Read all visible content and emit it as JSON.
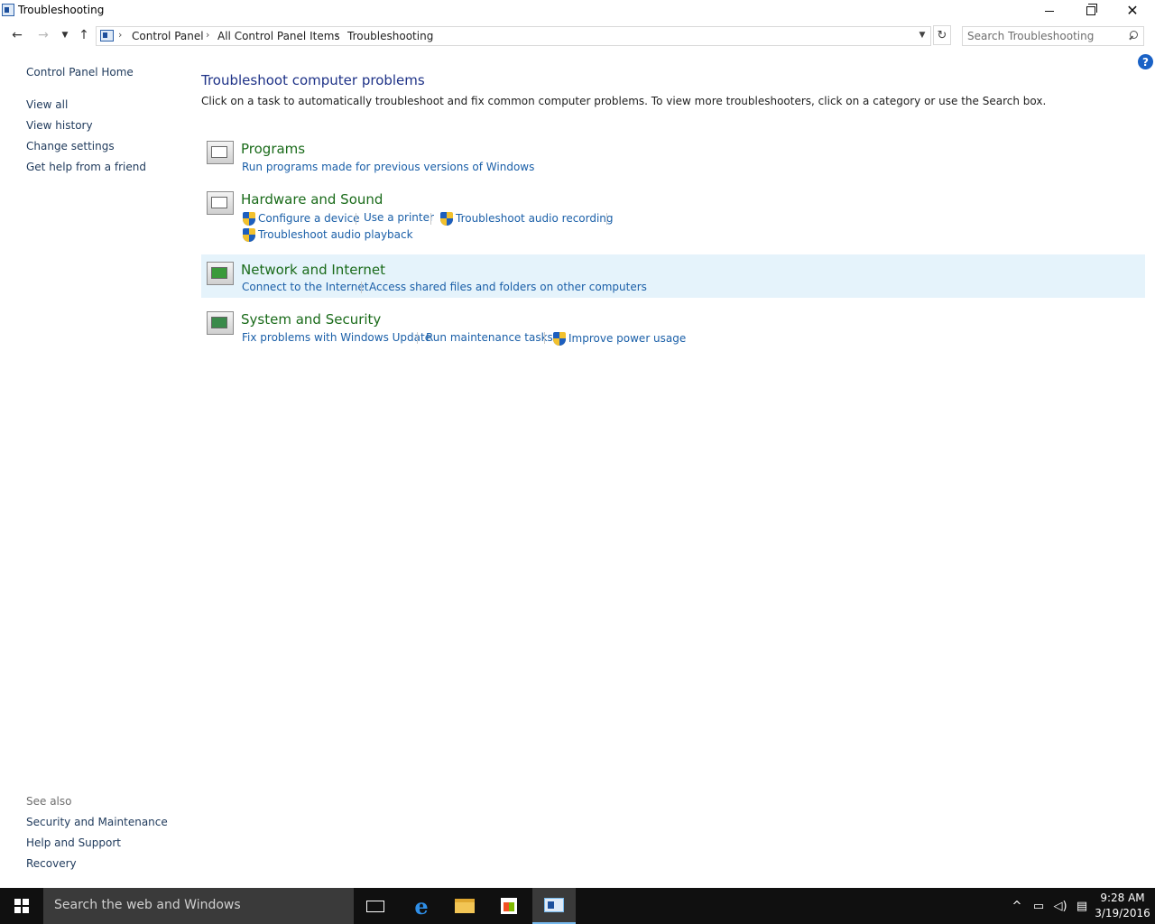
{
  "window": {
    "title": "Troubleshooting"
  },
  "address": {
    "breadcrumbs": [
      "Control Panel",
      "All Control Panel Items",
      "Troubleshooting"
    ]
  },
  "search": {
    "placeholder": "Search Troubleshooting"
  },
  "left_pane": {
    "home": "Control Panel Home",
    "links": [
      "View all",
      "View history",
      "Change settings",
      "Get help from a friend"
    ],
    "see_also_heading": "See also",
    "see_also": [
      "Security and Maintenance",
      "Help and Support",
      "Recovery"
    ]
  },
  "main": {
    "title": "Troubleshoot computer problems",
    "description": "Click on a task to automatically troubleshoot and fix common computer problems. To view more troubleshooters, click on a category or use the Search box.",
    "categories": [
      {
        "title": "Programs",
        "icon": "programs-icon",
        "tasks": [
          "Run programs made for previous versions of Windows"
        ]
      },
      {
        "title": "Hardware and Sound",
        "icon": "hardware-sound-icon",
        "tasks": [
          "Configure a device",
          "Use a printer",
          "Troubleshoot audio recording",
          "Troubleshoot audio playback"
        ]
      },
      {
        "title": "Network and Internet",
        "icon": "network-icon",
        "tasks": [
          "Connect to the Internet",
          "Access shared files and folders on other computers"
        ]
      },
      {
        "title": "System and Security",
        "icon": "system-security-icon",
        "tasks": [
          "Fix problems with Windows Update",
          "Run maintenance tasks",
          "Improve power usage"
        ]
      }
    ]
  },
  "taskbar": {
    "search_placeholder": "Search the web and Windows",
    "time": "9:28 AM",
    "date": "3/19/2016"
  },
  "colors": {
    "link": "#1a5fa8",
    "category_title": "#1a6b1a",
    "page_title": "#1e3287",
    "highlight_row": "#e5f3fb",
    "taskbar": "#101010"
  }
}
